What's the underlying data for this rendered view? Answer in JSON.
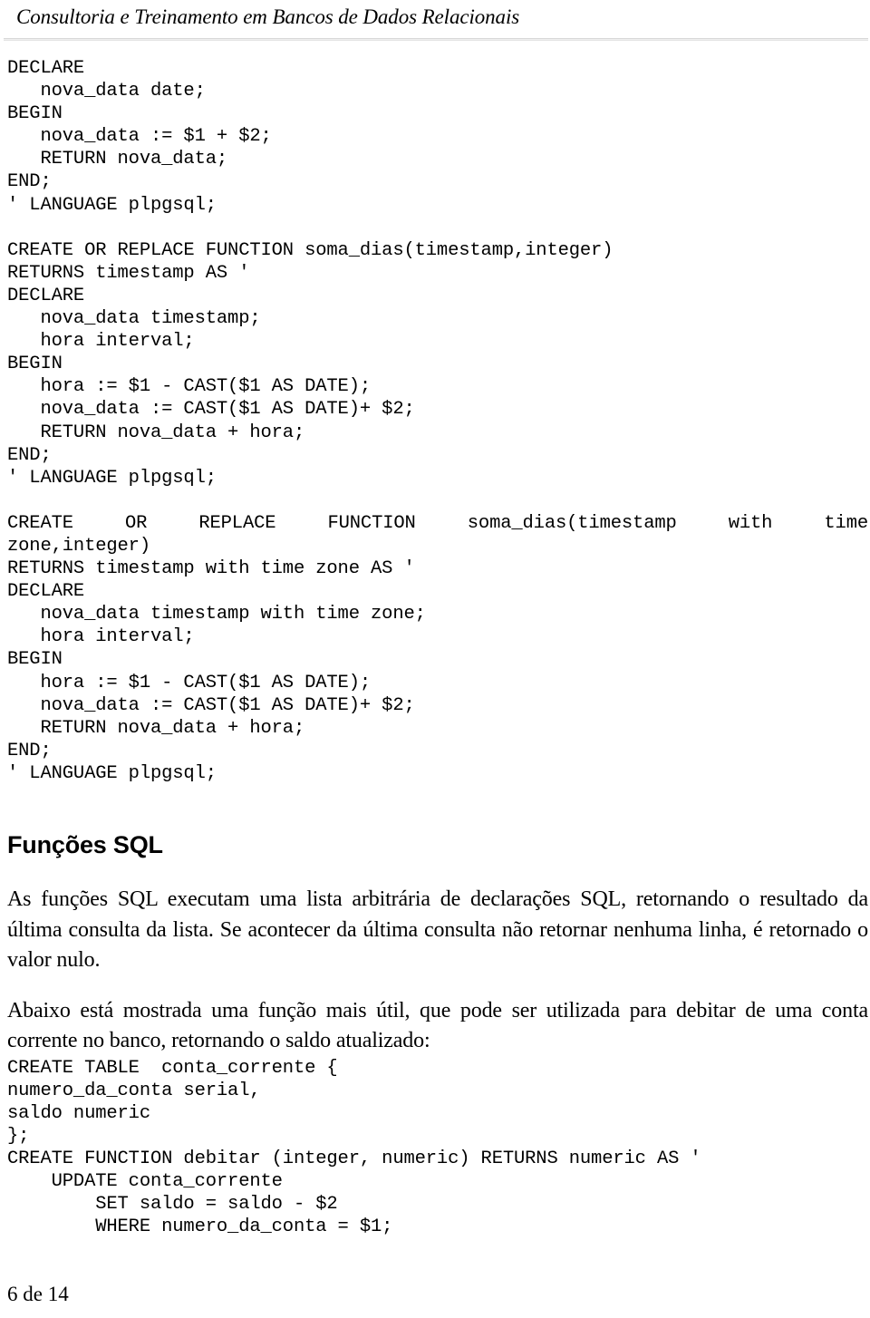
{
  "header": {
    "title": "Consultoria e Treinamento em Bancos de Dados Relacionais"
  },
  "footer": {
    "page_label": "6 de 14"
  },
  "main": {
    "code_block_1": "DECLARE\n   nova_data date;\nBEGIN\n   nova_data := $1 + $2;\n   RETURN nova_data;\nEND;\n' LANGUAGE plpgsql;",
    "code_block_2": "CREATE OR REPLACE FUNCTION soma_dias(timestamp,integer)\nRETURNS timestamp AS '\nDECLARE\n   nova_data timestamp;\n   hora interval;\nBEGIN\n   hora := $1 - CAST($1 AS DATE);\n   nova_data := CAST($1 AS DATE)+ $2;\n   RETURN nova_data + hora;\nEND;\n' LANGUAGE plpgsql;",
    "code_block_3_justified_line": "CREATE OR REPLACE FUNCTION soma_dias(timestamp with time",
    "code_block_3_rest": "zone,integer)\nRETURNS timestamp with time zone AS '\nDECLARE\n   nova_data timestamp with time zone;\n   hora interval;\nBEGIN\n   hora := $1 - CAST($1 AS DATE);\n   nova_data := CAST($1 AS DATE)+ $2;\n   RETURN nova_data + hora;\nEND;\n' LANGUAGE plpgsql;",
    "section_heading": "Funções SQL",
    "paragraph_1": "As funções SQL executam uma lista arbitrária de declarações SQL, retornando o resultado da última consulta da lista. Se acontecer da última consulta não retornar nenhuma linha, é retornado o valor nulo.",
    "paragraph_2": "Abaixo está mostrada uma função mais útil, que pode ser utilizada para debitar de uma conta corrente no banco, retornando o saldo atualizado:",
    "code_block_4": "CREATE TABLE  conta_corrente {\nnumero_da_conta serial,\nsaldo numeric\n};\nCREATE FUNCTION debitar (integer, numeric) RETURNS numeric AS '\n    UPDATE conta_corrente\n        SET saldo = saldo - $2\n        WHERE numero_da_conta = $1;"
  }
}
